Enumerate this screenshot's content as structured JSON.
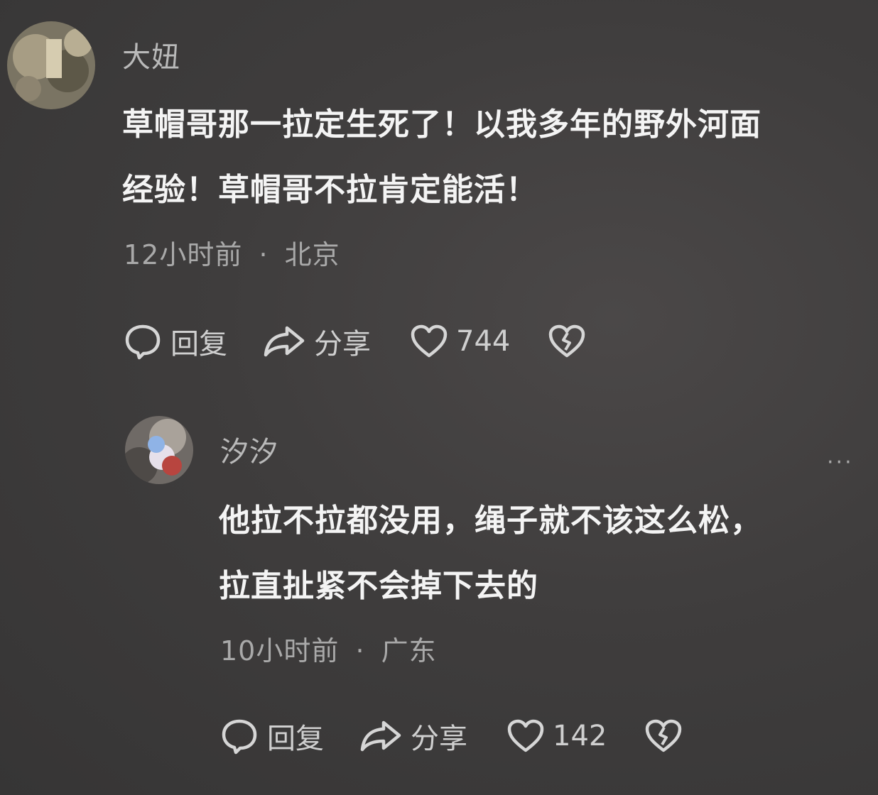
{
  "comments": [
    {
      "username": "大妞",
      "text_line1": "草帽哥那一拉定生死了！以我多年的野外河面",
      "text_line2": "经验！草帽哥不拉肯定能活！",
      "time": "12小时前",
      "location": "北京",
      "reply_label": "回复",
      "share_label": "分享",
      "likes": "744"
    },
    {
      "username": "汐汐",
      "text_line1": "他拉不拉都没用，绳子就不该这么松，",
      "text_line2": "拉直扯紧不会掉下去的",
      "time": "10小时前",
      "location": "广东",
      "reply_label": "回复",
      "share_label": "分享",
      "likes": "142",
      "more": "···"
    }
  ],
  "separator": "·"
}
